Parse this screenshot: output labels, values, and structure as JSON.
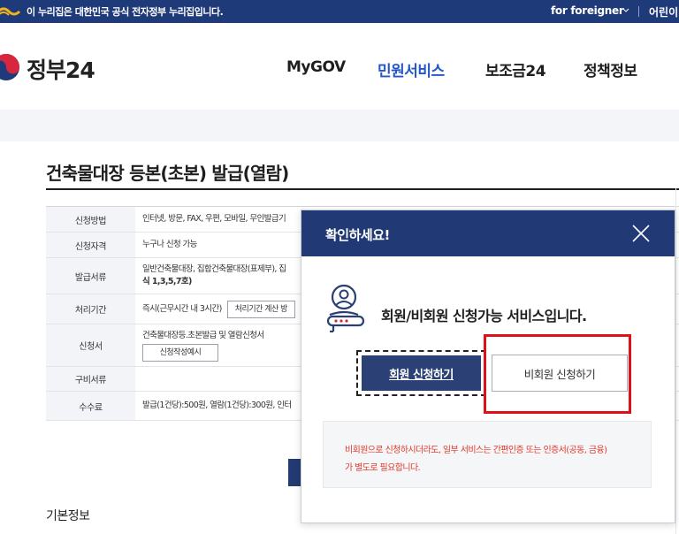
{
  "gov_banner": {
    "notice": "이 누리집은 대한민국 공식 전자정부 누리집입니다.",
    "language": "for foreigner",
    "kids": "어린이"
  },
  "header": {
    "logo_text": "정부24",
    "nav": [
      "MyGOV",
      "민원서비스",
      "보조금24",
      "정책정보"
    ],
    "active_nav": "민원서비스"
  },
  "page": {
    "title": "건축물대장 등본(초본) 발급(열람)",
    "basic_info_title": "기본정보"
  },
  "info_table": {
    "rows": [
      {
        "label": "신청방법",
        "value": "인터넷, 방문, FAX, 우편, 모바일, 무인발급기"
      },
      {
        "label": "신청자격",
        "value": "누구나 신청 가능"
      },
      {
        "label": "발급서류",
        "value": "일반건축물대장, 집합건축물대장(표제부), 집",
        "value2": "식 1,3,5,7호)"
      },
      {
        "label": "처리기간",
        "value": "즉시(근무시간 내 3시간)",
        "button": "처리기간 계산 방"
      },
      {
        "label": "신청서",
        "value": "건축물대장등.초본발급 및 열람신청서",
        "button": "신청작성예시"
      },
      {
        "label": "구비서류",
        "value": ""
      },
      {
        "label": "수수료",
        "value": "발급(1건당):500원, 열람(1건당):300원, 인터"
      }
    ]
  },
  "modal": {
    "title": "확인하세요!",
    "message": "회원/비회원 신청가능 서비스입니다.",
    "member_button": "회원 신청하기",
    "guest_button": "비회원 신청하기",
    "note_line1": "비회원으로 신청하시더라도, 일부 서비스는 간편인증 또는 인증서(공동, 금융)",
    "note_line2": "가 별도로 필요합니다."
  },
  "colors": {
    "gov_navy": "#1f3a78",
    "accent_blue": "#2457c5",
    "member_button": "#2b4074",
    "highlight_red": "#e0101a",
    "note_red": "#e03a2d"
  }
}
